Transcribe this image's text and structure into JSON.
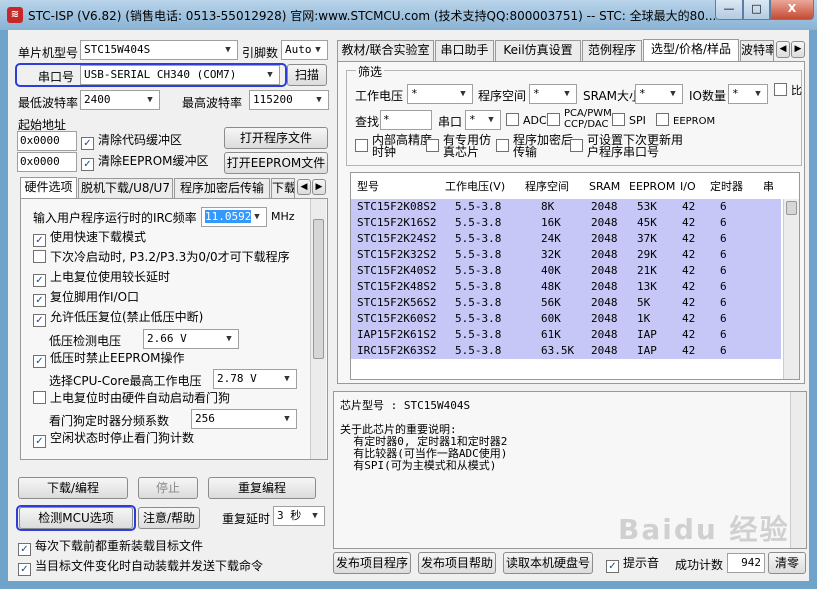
{
  "window": {
    "title": "STC-ISP (V6.82) (销售电话: 0513-55012928) 官网:www.STCMCU.com  (技术支持QQ:800003751)  -- STC: 全球最大的80...",
    "min_label": "—",
    "max_label": "□",
    "close_label": "X"
  },
  "left": {
    "chip_label": "单片机型号",
    "chip_value": "STC15W404S",
    "pin_label": "引脚数",
    "pin_value": "Auto",
    "port_label": "串口号",
    "port_value": "USB-SERIAL CH340 (COM7)",
    "scan_button": "扫描",
    "min_baud_label": "最低波特率",
    "min_baud_value": "2400",
    "max_baud_label": "最高波特率",
    "max_baud_value": "115200",
    "start_addr_label": "起始地址",
    "addr1": "0x0000",
    "addr2": "0x0000",
    "clear_code_label": "清除代码缓冲区",
    "clear_eeprom_label": "清除EEPROM缓冲区",
    "open_prog_button": "打开程序文件",
    "open_eeprom_button": "打开EEPROM文件"
  },
  "left_tabs": [
    "硬件选项",
    "脱机下载/U8/U7",
    "程序加密后传输",
    "下载"
  ],
  "hw": {
    "irc_label": "输入用户程序运行时的IRC频率",
    "irc_value": "11.0592",
    "irc_unit": "MHz",
    "options": [
      {
        "label": "使用快速下载模式",
        "checked": "✓"
      },
      {
        "label": "下次冷启动时, P3.2/P3.3为0/0才可下载程序",
        "checked": ""
      },
      {
        "label": "上电复位使用较长延时",
        "checked": "✓"
      },
      {
        "label": "复位脚用作I/O口",
        "checked": "✓"
      },
      {
        "label": "允许低压复位(禁止低压中断)",
        "checked": "✓"
      }
    ],
    "lv_label": "低压检测电压",
    "lv_value": "2.66 V",
    "lv_irq_label": "低压时禁止EEPROM操作",
    "lv_irq_checked": "✓",
    "cpu_core_label": "选择CPU-Core最高工作电压",
    "cpu_core_value": "2.78 V",
    "wdt_label": "上电复位时由硬件自动启动看门狗",
    "wdt_checked": "",
    "wdt_div_label": "看门狗定时器分频系数",
    "wdt_div_value": "256",
    "idle_wdt_label": "空闲状态时停止看门狗计数",
    "idle_wdt_checked": "✓"
  },
  "bottom_left": {
    "download_button": "下载/编程",
    "stop_button": "停止",
    "reprogram_button": "重复编程",
    "detect_button": "检测MCU选项",
    "help_button": "注意/帮助",
    "delay_label": "重复延时",
    "delay_value": "3 秒",
    "reload_label": "每次下载前都重新装载目标文件",
    "autoload_label": "当目标文件变化时自动装载并发送下载命令"
  },
  "right_tabs": [
    "教材/联合实验室",
    "串口助手",
    "Keil仿真设置",
    "范例程序",
    "选型/价格/样品",
    "波特率"
  ],
  "filter": {
    "group_label": "筛选",
    "voltage_label": "工作电压",
    "program_label": "程序空间",
    "sram_label": "SRAM大小",
    "io_label": "IO数量",
    "star": "*",
    "compare_label": "比较器(可当作掉电检测)",
    "find_label": "查找",
    "find_value": "*",
    "uart_label": "串口",
    "adc_label": "ADC",
    "pca_label": "PCA/PWM CCP/DAC",
    "spi_label": "SPI",
    "eeprom_label": "EEPROM",
    "extra": [
      "内部高精度时钟",
      "有专用仿真芯片",
      "程序加密后传输",
      "可设置下次更新用户程序串口号"
    ]
  },
  "table": {
    "headers": [
      "型号",
      "工作电压(V)",
      "程序空间",
      "SRAM",
      "EEPROM",
      "I/O",
      "定时器",
      "串"
    ],
    "rows": [
      [
        "STC15F2K08S2",
        "5.5-3.8",
        "8K",
        "2048",
        "53K",
        "42",
        "6"
      ],
      [
        "STC15F2K16S2",
        "5.5-3.8",
        "16K",
        "2048",
        "45K",
        "42",
        "6"
      ],
      [
        "STC15F2K24S2",
        "5.5-3.8",
        "24K",
        "2048",
        "37K",
        "42",
        "6"
      ],
      [
        "STC15F2K32S2",
        "5.5-3.8",
        "32K",
        "2048",
        "29K",
        "42",
        "6"
      ],
      [
        "STC15F2K40S2",
        "5.5-3.8",
        "40K",
        "2048",
        "21K",
        "42",
        "6"
      ],
      [
        "STC15F2K48S2",
        "5.5-3.8",
        "48K",
        "2048",
        "13K",
        "42",
        "6"
      ],
      [
        "STC15F2K56S2",
        "5.5-3.8",
        "56K",
        "2048",
        "5K",
        "42",
        "6"
      ],
      [
        "STC15F2K60S2",
        "5.5-3.8",
        "60K",
        "2048",
        "1K",
        "42",
        "6"
      ],
      [
        "IAP15F2K61S2",
        "5.5-3.8",
        "61K",
        "2048",
        "IAP",
        "42",
        "6"
      ],
      [
        "IRC15F2K63S2",
        "5.5-3.8",
        "63.5K",
        "2048",
        "IAP",
        "42",
        "6"
      ]
    ]
  },
  "info": {
    "text": "芯片型号 : STC15W404S\n\n关于此芯片的重要说明:\n  有定时器0, 定时器1和定时器2\n  有比较器(可当作一路ADC使用)\n  有SPI(可为主模式和从模式)"
  },
  "bottom_right": {
    "publish_prog": "发布项目程序",
    "publish_help": "发布项目帮助",
    "read_disk": "读取本机硬盘号",
    "sound_label": "提示音",
    "success_label": "成功计数",
    "success_count": "942",
    "clear_button": "清零"
  },
  "watermark": "Baidu 经验"
}
